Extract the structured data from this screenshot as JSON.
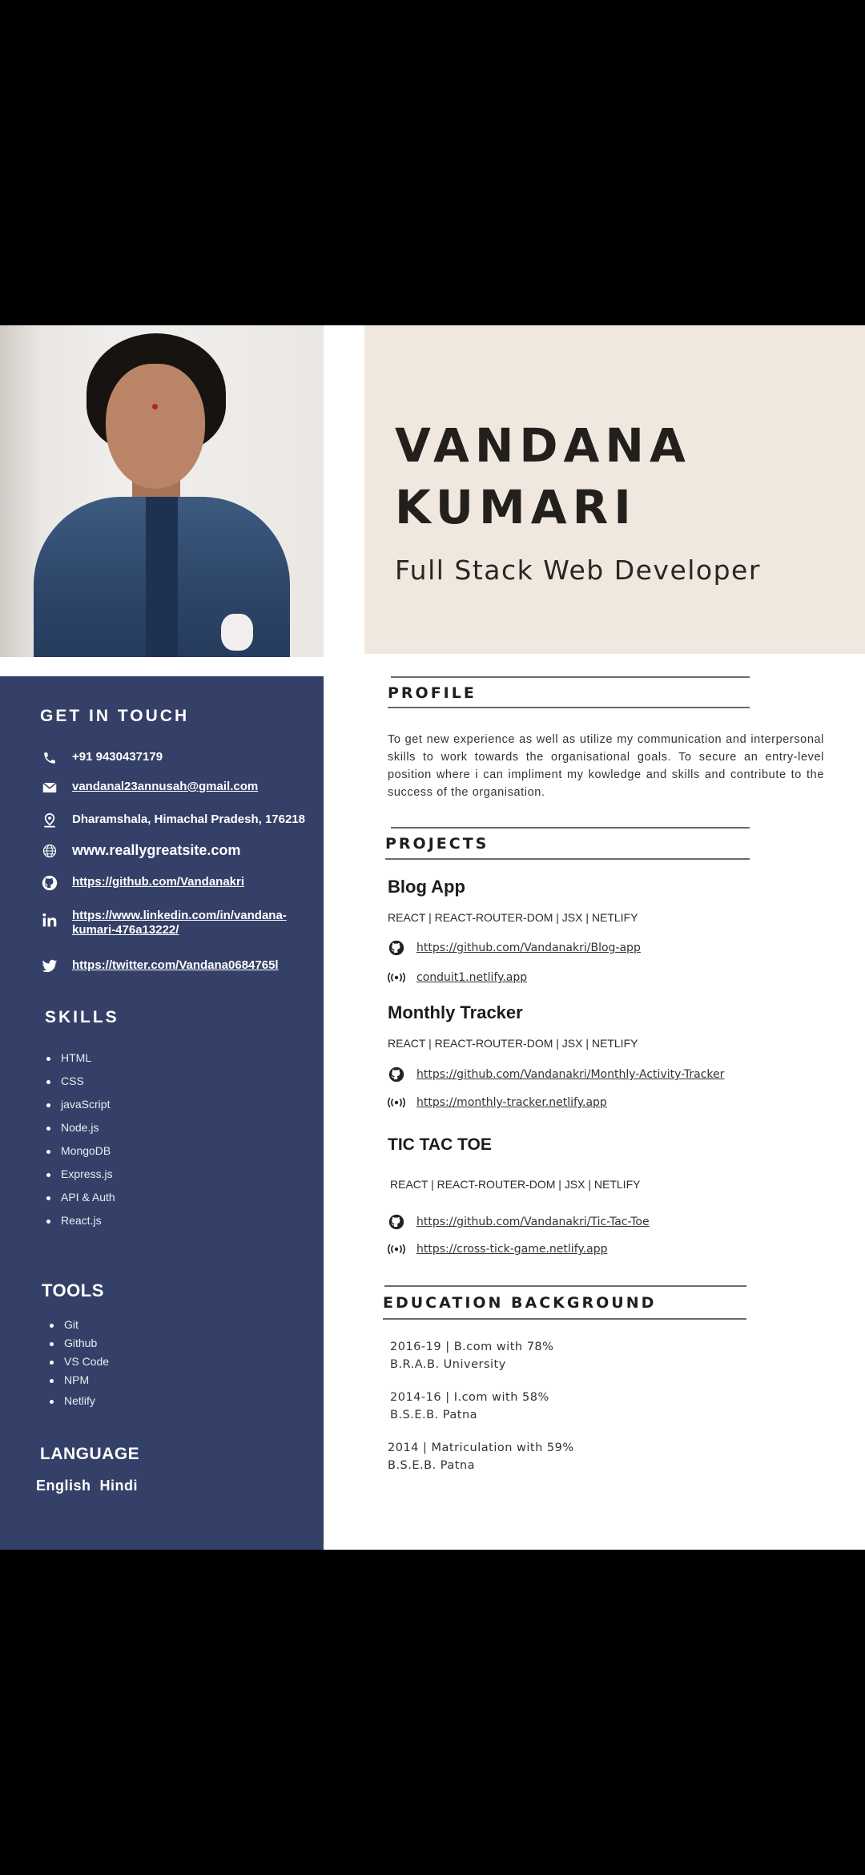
{
  "person": {
    "name_line1": "VANDANA",
    "name_line2": "KUMARI",
    "role": "Full Stack Web Developer"
  },
  "contact": {
    "heading": "GET IN TOUCH",
    "items": [
      {
        "icon": "phone-icon",
        "text": "+91 9430437179"
      },
      {
        "icon": "mail-icon",
        "text": "vandanal23annusah@gmail.com"
      },
      {
        "icon": "location-icon",
        "text": "Dharamshala, Himachal Pradesh, 176218"
      },
      {
        "icon": "globe-icon",
        "text": "www.reallygreatsite.com"
      },
      {
        "icon": "github-icon",
        "text": "https://github.com/Vandanakri"
      },
      {
        "icon": "linkedin-icon",
        "text": "https://www.linkedin.com/in/vandana-kumari-476a13222/"
      },
      {
        "icon": "twitter-icon",
        "text": "https://twitter.com/Vandana0684765l"
      }
    ]
  },
  "skills": {
    "heading": "SKILLS",
    "items": [
      "HTML",
      "CSS",
      "javaScript",
      "Node.js",
      "MongoDB",
      "Express.js",
      "API & Auth",
      "React.js"
    ]
  },
  "tools": {
    "heading": "TOOLS",
    "items": [
      "Git",
      "Github",
      "VS Code",
      "NPM",
      "Netlify"
    ]
  },
  "language": {
    "heading": "LANGUAGE",
    "items_text": "English  Hindi"
  },
  "profile": {
    "heading": "PROFILE",
    "text": "To get new experience as well as utilize my communication and interpersonal skills to work towards the organisational goals. To secure an entry-level position where i can impliment my kowledge and skills and contribute to the success of the organisation."
  },
  "projects": {
    "heading": "PROJECTS",
    "items": [
      {
        "title": "Blog App",
        "stack": "REACT | REACT-ROUTER-DOM | JSX | NETLIFY",
        "repo": "https://github.com/Vandanakri/Blog-app",
        "live": "conduit1.netlify.app"
      },
      {
        "title": "Monthly Tracker",
        "stack": "REACT | REACT-ROUTER-DOM | JSX | NETLIFY",
        "repo": "https://github.com/Vandanakri/Monthly-Activity-Tracker",
        "live": "https://monthly-tracker.netlify.app"
      },
      {
        "title": "TIC TAC TOE",
        "stack": "REACT | REACT-ROUTER-DOM | JSX | NETLIFY",
        "repo": "https://github.com/Vandanakri/Tic-Tac-Toe",
        "live": "https://cross-tick-game.netlify.app"
      }
    ]
  },
  "education": {
    "heading": "EDUCATION BACKGROUND",
    "items": [
      {
        "line1": "2016-19 | B.com with 78%",
        "line2": "B.R.A.B. University"
      },
      {
        "line1": "2014-16 | I.com with 58%",
        "line2": "B.S.E.B. Patna"
      },
      {
        "line1": "2014 | Matriculation with 59%",
        "line2": "B.S.E.B. Patna"
      }
    ]
  },
  "colors": {
    "sidebar": "#344067",
    "header_box": "#f0e7df",
    "background": "#000000"
  }
}
